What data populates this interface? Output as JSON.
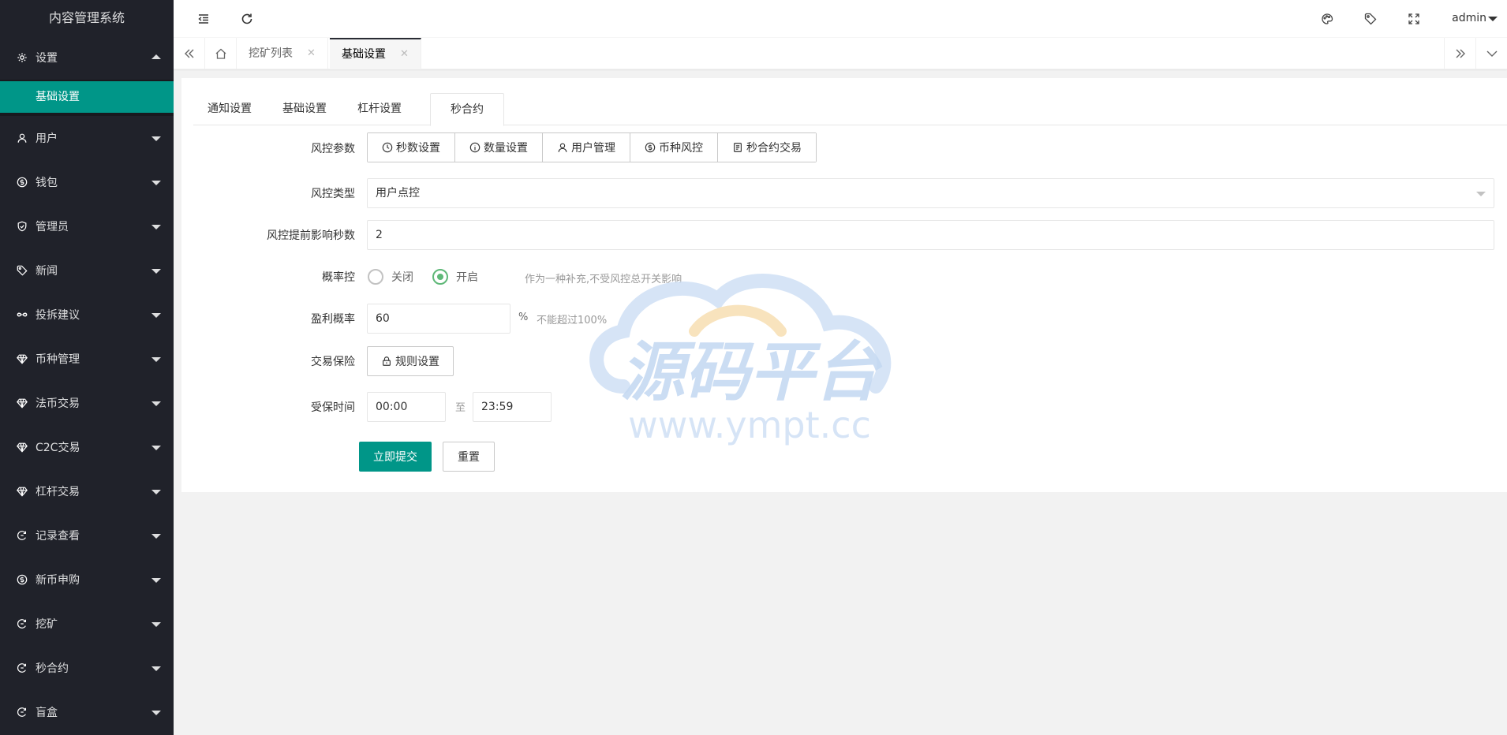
{
  "app": {
    "title": "内容管理系统"
  },
  "sidebar": {
    "items": [
      {
        "label": "设置",
        "icon": "gear-icon",
        "expanded": true,
        "sub": [
          {
            "label": "基础设置",
            "active": true
          }
        ]
      },
      {
        "label": "用户",
        "icon": "user-icon"
      },
      {
        "label": "钱包",
        "icon": "dollar-icon"
      },
      {
        "label": "管理员",
        "icon": "shield-icon"
      },
      {
        "label": "新闻",
        "icon": "tag-icon"
      },
      {
        "label": "投拆建议",
        "icon": "link-icon"
      },
      {
        "label": "币种管理",
        "icon": "diamond-icon"
      },
      {
        "label": "法币交易",
        "icon": "diamond-icon"
      },
      {
        "label": "C2C交易",
        "icon": "diamond-icon"
      },
      {
        "label": "杠杆交易",
        "icon": "diamond-icon"
      },
      {
        "label": "记录查看",
        "icon": "refresh-icon"
      },
      {
        "label": "新币申购",
        "icon": "dollar-icon"
      },
      {
        "label": "挖矿",
        "icon": "refresh-icon"
      },
      {
        "label": "秒合约",
        "icon": "refresh-icon"
      },
      {
        "label": "盲盒",
        "icon": "refresh-icon"
      }
    ]
  },
  "header": {
    "user": "admin"
  },
  "pagetabs": [
    {
      "label": "挖矿列表",
      "active": false
    },
    {
      "label": "基础设置",
      "active": true
    }
  ],
  "content": {
    "tabs": [
      {
        "label": "通知设置"
      },
      {
        "label": "基础设置"
      },
      {
        "label": "杠杆设置"
      },
      {
        "label": "秒合约",
        "active": true
      }
    ],
    "risk_params": {
      "label": "风控参数",
      "buttons": [
        {
          "label": "秒数设置",
          "icon": "clock-icon"
        },
        {
          "label": "数量设置",
          "icon": "info-icon"
        },
        {
          "label": "用户管理",
          "icon": "user-icon"
        },
        {
          "label": "币种风控",
          "icon": "dollar-icon"
        },
        {
          "label": "秒合约交易",
          "icon": "document-icon"
        }
      ]
    },
    "risk_type": {
      "label": "风控类型",
      "value": "用户点控"
    },
    "advance_seconds": {
      "label": "风控提前影响秒数",
      "value": "2"
    },
    "prob_control": {
      "label": "概率控",
      "off": "关闭",
      "on": "开启",
      "selected": "on",
      "hint": "作为一种补充,不受风控总开关影响"
    },
    "win_rate": {
      "label": "盈利概率",
      "value": "60",
      "unit": "%",
      "hint": "不能超过100%"
    },
    "insurance": {
      "label": "交易保险",
      "button": "规则设置"
    },
    "protect_time": {
      "label": "受保时间",
      "start": "00:00",
      "sep": "至",
      "end": "23:59"
    },
    "submit": "立即提交",
    "reset": "重置"
  },
  "watermark": {
    "title": "源码平台",
    "url": "www.ympt.cc"
  },
  "colors": {
    "sidebar_bg": "#20222a",
    "accent": "#009688",
    "radio_on": "#5fb878"
  }
}
